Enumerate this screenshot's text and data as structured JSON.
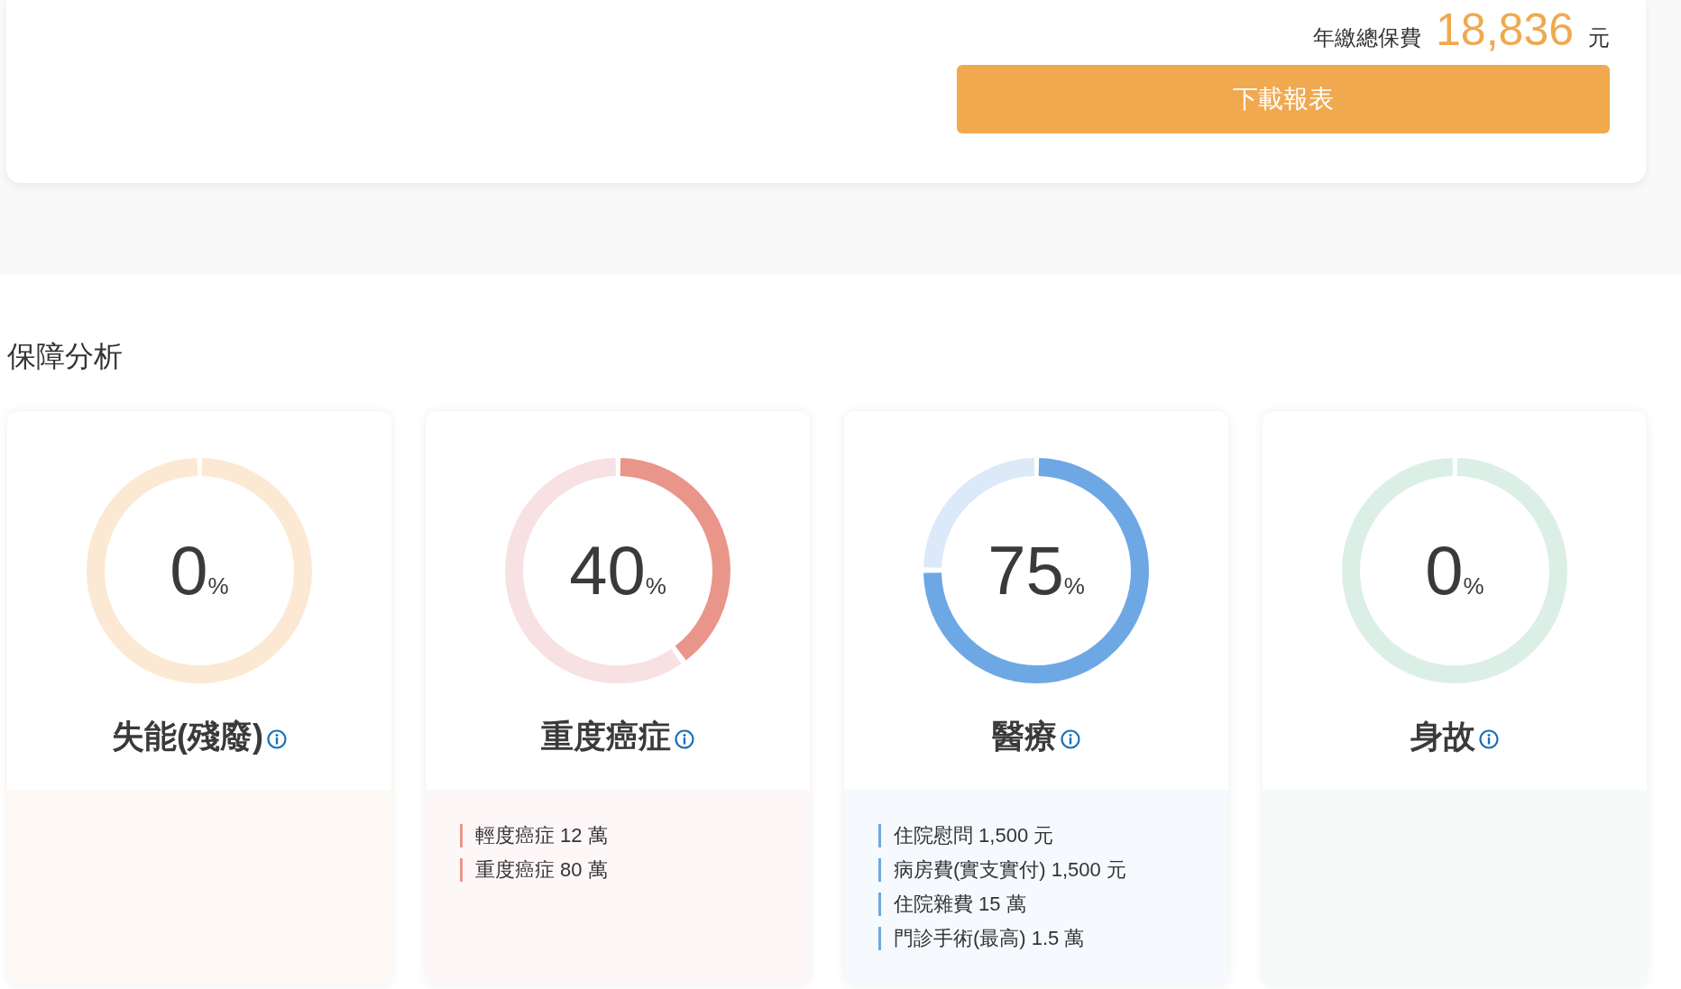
{
  "summary": {
    "label": "年繳總保費",
    "amount": "18,836",
    "unit": "元",
    "button": "下載報表"
  },
  "section_title": "保障分析",
  "cards": [
    {
      "title": "失能(殘廢)",
      "value": "0",
      "unit": "%",
      "track": {
        "color": "#fbe9d4"
      }
    },
    {
      "title": "重度癌症",
      "value": "40",
      "unit": "%",
      "track": {
        "color": "#f8e1e2"
      },
      "fill": {
        "level": 0.4,
        "color": "#e9958a"
      },
      "items": [
        "輕度癌症 12 萬",
        "重度癌症 80 萬"
      ]
    },
    {
      "title": "醫療",
      "value": "75",
      "unit": "%",
      "track": {
        "color": "#dbe9f8"
      },
      "fill": {
        "level": 0.75,
        "color": "#6ea8e4"
      },
      "items": [
        "住院慰問 1,500 元",
        "病房費(實支實付) 1,500 元",
        "住院雜費 15 萬",
        "門診手術(最高) 1.5 萬"
      ]
    },
    {
      "title": "身故",
      "value": "0",
      "unit": "%",
      "track": {
        "color": "#dcefe6"
      }
    }
  ]
}
